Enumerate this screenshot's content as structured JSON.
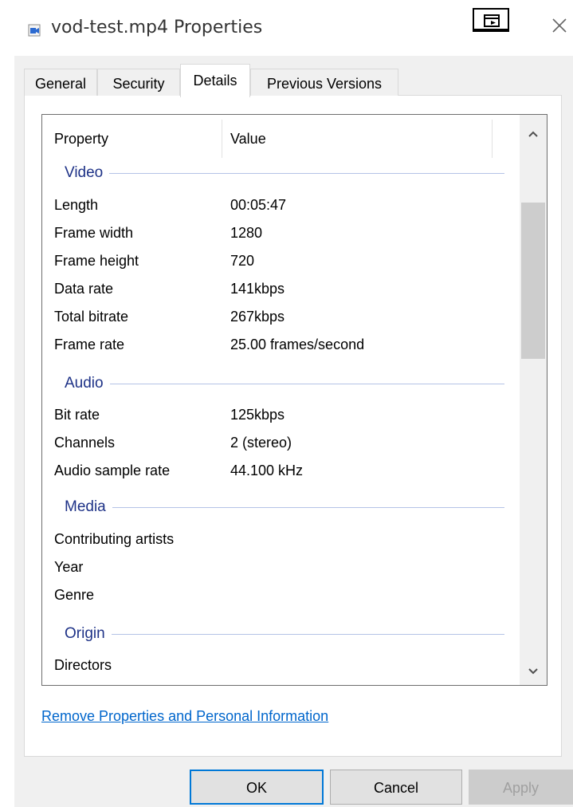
{
  "window": {
    "title": "vod-test.mp4 Properties",
    "icon": "video-file-icon"
  },
  "tabs": [
    {
      "label": "General",
      "active": false
    },
    {
      "label": "Security",
      "active": false
    },
    {
      "label": "Details",
      "active": true
    },
    {
      "label": "Previous Versions",
      "active": false
    }
  ],
  "list": {
    "headers": {
      "property": "Property",
      "value": "Value"
    },
    "groups": {
      "video": {
        "title": "Video",
        "rows": [
          {
            "property": "Length",
            "value": "00:05:47"
          },
          {
            "property": "Frame width",
            "value": "1280"
          },
          {
            "property": "Frame height",
            "value": "720"
          },
          {
            "property": "Data rate",
            "value": "141kbps"
          },
          {
            "property": "Total bitrate",
            "value": "267kbps"
          },
          {
            "property": "Frame rate",
            "value": "25.00 frames/second"
          }
        ]
      },
      "audio": {
        "title": "Audio",
        "rows": [
          {
            "property": "Bit rate",
            "value": "125kbps"
          },
          {
            "property": "Channels",
            "value": "2 (stereo)"
          },
          {
            "property": "Audio sample rate",
            "value": "44.100 kHz"
          }
        ]
      },
      "media": {
        "title": "Media",
        "rows": [
          {
            "property": "Contributing artists",
            "value": ""
          },
          {
            "property": "Year",
            "value": ""
          },
          {
            "property": "Genre",
            "value": ""
          }
        ]
      },
      "origin": {
        "title": "Origin",
        "rows": [
          {
            "property": "Directors",
            "value": ""
          }
        ]
      }
    }
  },
  "link": {
    "label": "Remove Properties and Personal Information"
  },
  "buttons": {
    "ok": "OK",
    "cancel": "Cancel",
    "apply": "Apply"
  },
  "colors": {
    "accent": "#0078d7",
    "link": "#0066cc",
    "group_title": "#1e3287"
  }
}
